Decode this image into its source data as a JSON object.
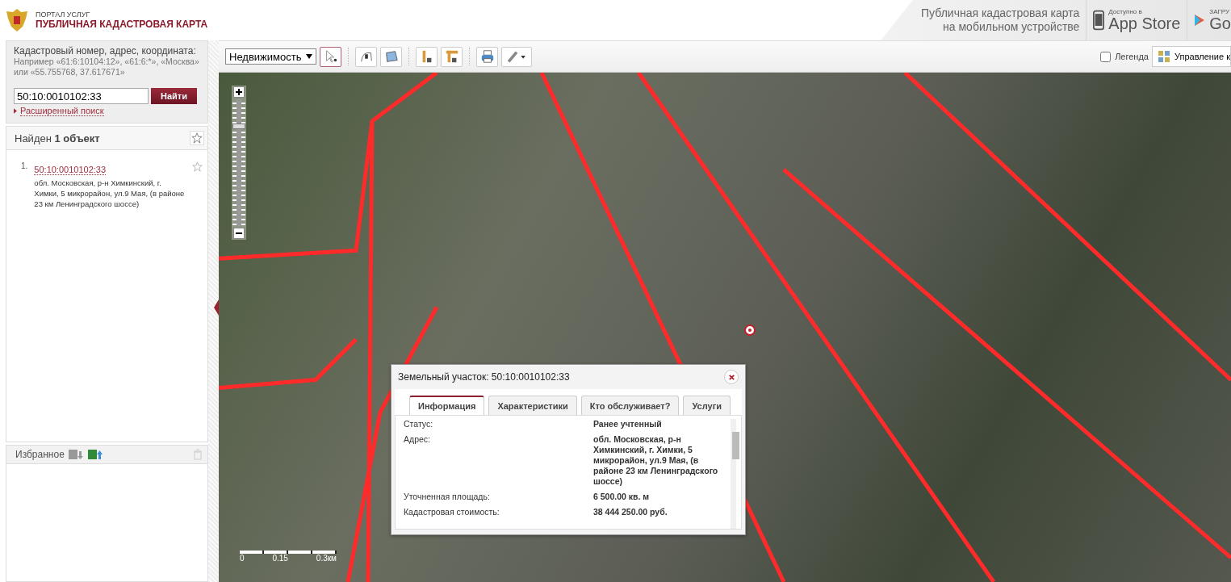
{
  "header": {
    "portal": "ПОРТАЛ УСЛУГ",
    "title": "ПУБЛИЧНАЯ КАДАСТРОВАЯ КАРТА",
    "mobile_line1": "Публичная кадастровая карта",
    "mobile_line2": "на мобильном устройстве",
    "appstore_small": "Доступно в",
    "appstore_big": "App Store",
    "gplay_small": "ЗАГРУ",
    "gplay_big": "Go"
  },
  "search": {
    "label": "Кадастровый номер, адрес, координата:",
    "hint": "Например «61:6:10104:12», «61:6:*», «Москва» или «55.755768, 37.617671»",
    "value": "50:10:0010102:33",
    "button": "Найти",
    "advanced": "Расширенный поиск"
  },
  "results": {
    "title": "Найден **1 объект**",
    "items": [
      {
        "number": "1.",
        "id": "50:10:0010102:33",
        "address": "обл. Московская, р-н Химкинский, г. Химки, 5 микрорайон, ул.9 Мая, (в районе 23 км Ленинградского шоссе)"
      }
    ]
  },
  "favorites": {
    "title": "Избранное"
  },
  "toolbar": {
    "layer_select": "Недвижимость",
    "legend": {
      "label": "Легенда",
      "checked": false
    },
    "manage": "Управление к"
  },
  "zoom": {
    "level": 0.8
  },
  "scale": {
    "labels": [
      "0",
      "0.15",
      "0.3км"
    ]
  },
  "popup": {
    "title": "Земельный участок: 50:10:0010102:33",
    "tabs": [
      {
        "label": "Информация",
        "selected": true
      },
      {
        "label": "Характеристики",
        "selected": false
      },
      {
        "label": "Кто обслуживает?",
        "selected": false
      },
      {
        "label": "Услуги",
        "selected": false
      }
    ],
    "rows": [
      {
        "label": "Статус:",
        "value": "Ранее учтенный"
      },
      {
        "label": "Адрес:",
        "value": "обл. Московская, р-н Химкинский, г. Химки, 5 микрорайон, ул.9 Мая, (в районе 23 км Ленинградского шоссе)"
      },
      {
        "label": "Уточненная площадь:",
        "value": "6 500.00 кв. м"
      },
      {
        "label": "Кадастровая стоимость:",
        "value": "38 444 250.00 руб."
      }
    ]
  }
}
